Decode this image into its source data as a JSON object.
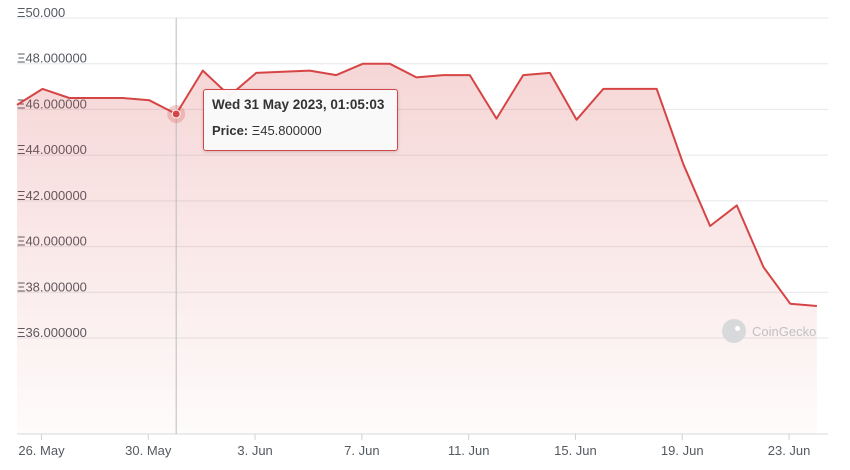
{
  "chart_data": {
    "type": "area",
    "currency_symbol": "Ξ",
    "y_ticks": [
      "Ξ50.000",
      "Ξ48.000000",
      "Ξ46.000000",
      "Ξ44.000000",
      "Ξ42.000000",
      "Ξ40.000000",
      "Ξ38.000000",
      "Ξ36.000000"
    ],
    "y_tick_values": [
      50,
      48,
      46,
      44,
      42,
      40,
      38,
      36
    ],
    "ylim": [
      31.8,
      50
    ],
    "x_ticks": [
      {
        "label": "26. May",
        "date": "2023-05-26"
      },
      {
        "label": "30. May",
        "date": "2023-05-30"
      },
      {
        "label": "3. Jun",
        "date": "2023-06-03"
      },
      {
        "label": "7. Jun",
        "date": "2023-06-07"
      },
      {
        "label": "11. Jun",
        "date": "2023-06-11"
      },
      {
        "label": "15. Jun",
        "date": "2023-06-15"
      },
      {
        "label": "19. Jun",
        "date": "2023-06-19"
      },
      {
        "label": "23. Jun",
        "date": "2023-06-23"
      }
    ],
    "xlim": [
      "2023-05-25T02:00",
      "2023-06-24T11:00"
    ],
    "series": [
      {
        "color": "#d64545",
        "x": [
          "2023-05-25T02:00",
          "2023-05-26T01:00",
          "2023-05-27T01:00",
          "2023-05-28T01:00",
          "2023-05-29T01:00",
          "2023-05-30T01:00",
          "2023-05-31T01:05",
          "2023-06-01T01:00",
          "2023-06-02T01:00",
          "2023-06-03T01:00",
          "2023-06-04T01:00",
          "2023-06-05T01:00",
          "2023-06-06T01:00",
          "2023-06-07T01:00",
          "2023-06-08T01:00",
          "2023-06-09T01:00",
          "2023-06-10T01:00",
          "2023-06-11T01:00",
          "2023-06-12T01:00",
          "2023-06-13T01:00",
          "2023-06-14T01:00",
          "2023-06-15T01:00",
          "2023-06-16T01:00",
          "2023-06-17T01:00",
          "2023-06-18T01:00",
          "2023-06-19T01:00",
          "2023-06-20T01:00",
          "2023-06-21T01:00",
          "2023-06-22T01:00",
          "2023-06-23T01:00",
          "2023-06-24T01:00"
        ],
        "values": [
          46.2,
          46.9,
          46.5,
          46.5,
          46.5,
          46.4,
          45.8,
          47.7,
          46.6,
          47.6,
          47.65,
          47.7,
          47.5,
          48.0,
          48.0,
          47.4,
          47.5,
          47.5,
          45.6,
          47.5,
          47.6,
          45.55,
          46.9,
          46.9,
          46.9,
          43.6,
          40.9,
          41.8,
          39.1,
          37.5,
          37.4
        ]
      }
    ],
    "grid": true,
    "legend": "none"
  },
  "hover": {
    "date": "2023-05-31T01:05",
    "value": 45.8,
    "tooltip_title": "Wed 31 May 2023, 01:05:03",
    "tooltip_price_label": "Price:",
    "tooltip_price_value": "Ξ45.800000"
  },
  "watermark": {
    "text": "CoinGecko",
    "icon": "coingecko-logo-icon"
  }
}
